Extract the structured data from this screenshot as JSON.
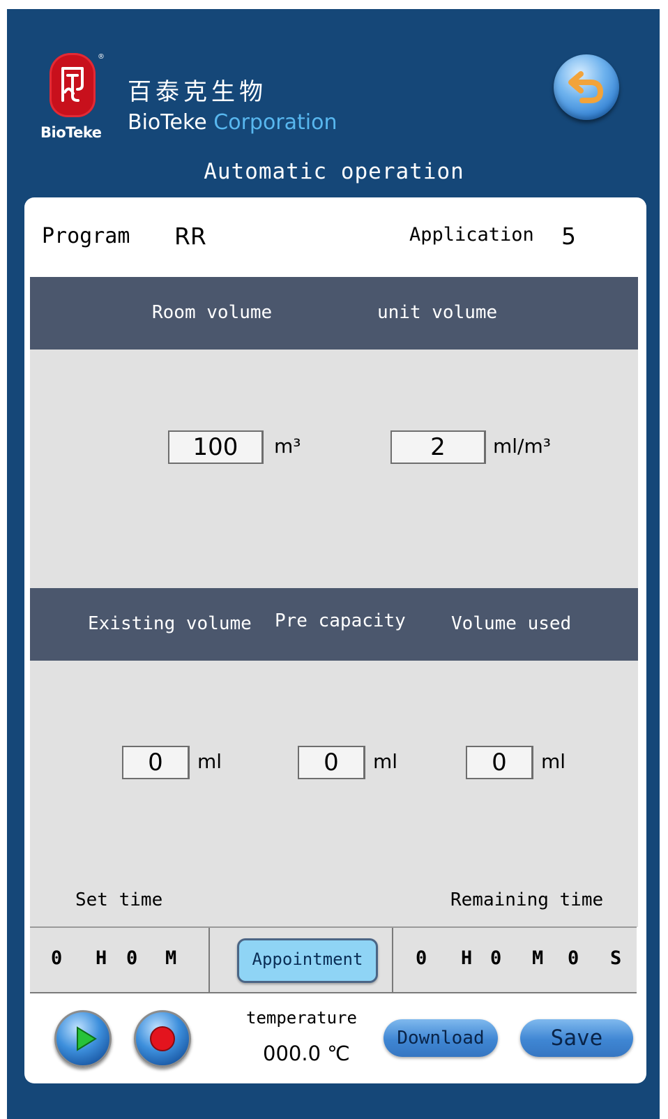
{
  "header": {
    "logo_text": "BioTeke",
    "brand_cn": "百泰克生物",
    "brand_en_word1": "BioTeke",
    "brand_en_word2": "Corporation",
    "title": "Automatic operation"
  },
  "program": {
    "label": "Program",
    "value": "RR",
    "application_label": "Application",
    "application_value": "5"
  },
  "volumes": {
    "room_volume_label": "Room volume",
    "unit_volume_label": "unit volume",
    "room_volume_value": "100",
    "room_volume_unit": "m³",
    "unit_volume_value": "2",
    "unit_volume_unit": "ml/m³"
  },
  "capacity": {
    "existing_label": "Existing volume",
    "pre_label": "Pre capacity",
    "used_label": "Volume used",
    "existing_value": "0",
    "pre_value": "0",
    "used_value": "0",
    "unit": "ml"
  },
  "timing": {
    "set_time_label": "Set time",
    "remaining_time_label": "Remaining time",
    "set_hours": "0",
    "set_h_unit": "H",
    "set_minutes": "0",
    "set_m_unit": "M",
    "appointment_label": "Appointment",
    "rem_hours": "0",
    "rem_h_unit": "H",
    "rem_minutes": "0",
    "rem_m_unit": "M",
    "rem_seconds": "0",
    "rem_s_unit": "S"
  },
  "footer": {
    "temperature_label": "temperature",
    "temperature_value": "000.0  ℃",
    "download_label": "Download",
    "save_label": "Save"
  },
  "icons": {
    "back": "back-arrow-icon",
    "start": "play-icon",
    "stop": "stop-record-icon"
  },
  "colors": {
    "frame": "#154778",
    "band": "#4b576d",
    "panel_gray": "#e1e1e1",
    "appointment": "#8fd4f5",
    "back_arrow": "#f2a33a"
  }
}
